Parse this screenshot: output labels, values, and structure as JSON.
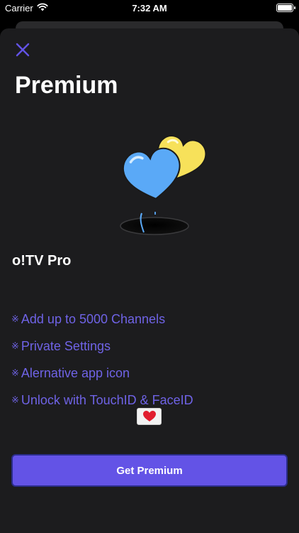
{
  "status_bar": {
    "carrier": "Carrier",
    "time": "7:32 AM",
    "icons": [
      "wifi-icon",
      "battery-icon"
    ]
  },
  "screen": {
    "close_icon": "close-icon",
    "title": "Premium",
    "illustration": "hearts-balloons-hole",
    "product_name": "o!TV Pro",
    "features": [
      {
        "mark": "※",
        "text": "Add up to 5000 Channels"
      },
      {
        "mark": "※",
        "text": "Private Settings"
      },
      {
        "mark": "※",
        "text": "Alernative app icon"
      },
      {
        "mark": "※",
        "text": "Unlock with TouchID & FaceID"
      }
    ],
    "gift_icon": "love-letter-icon",
    "cta_label": "Get Premium"
  },
  "colors": {
    "accent": "#6353e6",
    "feature_text": "#6f63e6",
    "sheet_background": "#1c1c1e",
    "heart_blue": "#5aa9f7",
    "heart_yellow": "#f7e15a"
  }
}
